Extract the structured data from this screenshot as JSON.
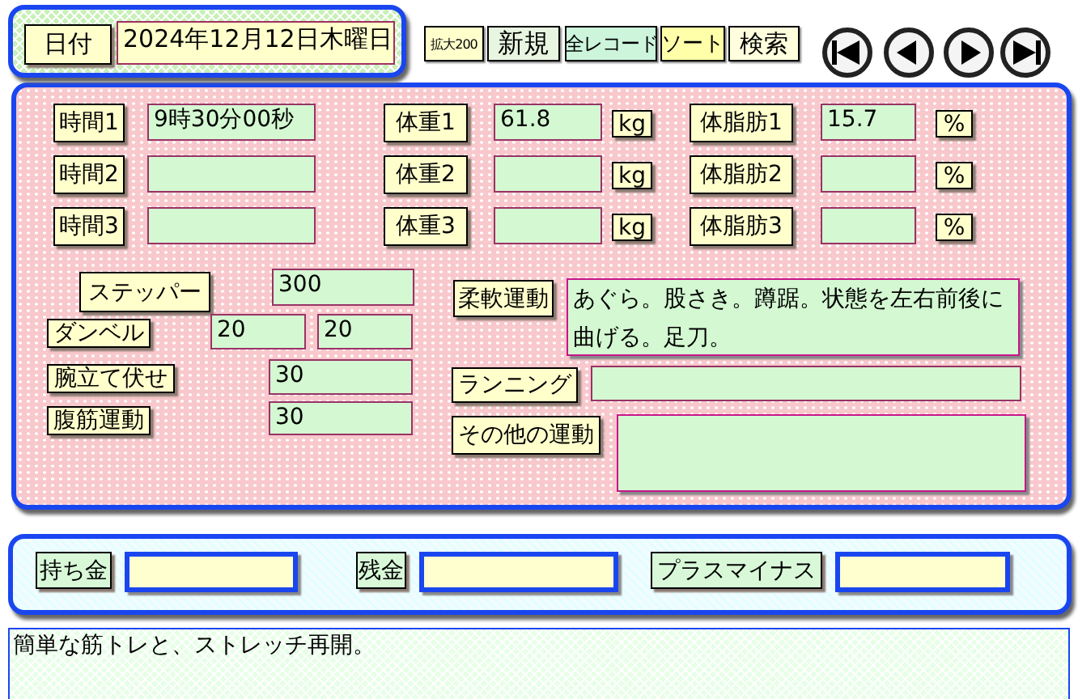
{
  "header": {
    "date_label": "日付",
    "date_value": "2024年12月12日木曜日",
    "buttons": [
      {
        "label": "拡大200",
        "color": "#ffffcc"
      },
      {
        "label": "新規",
        "color": "#e8f5e0"
      },
      {
        "label": "全レコード",
        "color": "#ccf5dc"
      },
      {
        "label": "ソート",
        "color": "#ffffaa"
      },
      {
        "label": "検索",
        "color": "#ffffdd"
      }
    ],
    "nav": [
      {
        "kind": "first"
      },
      {
        "kind": "prev"
      },
      {
        "kind": "next"
      },
      {
        "kind": "last"
      }
    ]
  },
  "measurements": [
    {
      "time_label": "時間1",
      "time_value": "9時30分00秒",
      "weight_label": "体重1",
      "weight_value": "61.8",
      "weight_unit": "kg",
      "fat_label": "体脂肪1",
      "fat_value": "15.7",
      "fat_unit": "%"
    },
    {
      "time_label": "時間2",
      "weight_label": "体重2",
      "weight_unit": "kg",
      "fat_label": "体脂肪2",
      "fat_unit": "%"
    },
    {
      "time_label": "時間3",
      "weight_label": "体重3",
      "weight_unit": "kg",
      "fat_label": "体脂肪3",
      "fat_unit": "%"
    }
  ],
  "exercises_left": [
    {
      "label": "ステッパー",
      "values": [
        "300"
      ]
    },
    {
      "label": "ダンベル",
      "values": [
        "20",
        "20"
      ]
    },
    {
      "label": "腕立て伏せ",
      "values": [
        "30"
      ]
    },
    {
      "label": "腹筋運動",
      "values": [
        "30"
      ]
    }
  ],
  "exercises_right": [
    {
      "label": "柔軟運動",
      "kind": "area",
      "value": "あぐら。股さき。蹲踞。状態を左右前後に曲げる。足刀。"
    },
    {
      "label": "ランニング",
      "kind": "line"
    },
    {
      "label": "その他の運動",
      "kind": "area"
    }
  ],
  "money": [
    {
      "label": "持ち金"
    },
    {
      "label": "残金"
    },
    {
      "label": "プラスマイナス"
    }
  ],
  "memo": "簡単な筋トレと、ストレッチ再開。"
}
